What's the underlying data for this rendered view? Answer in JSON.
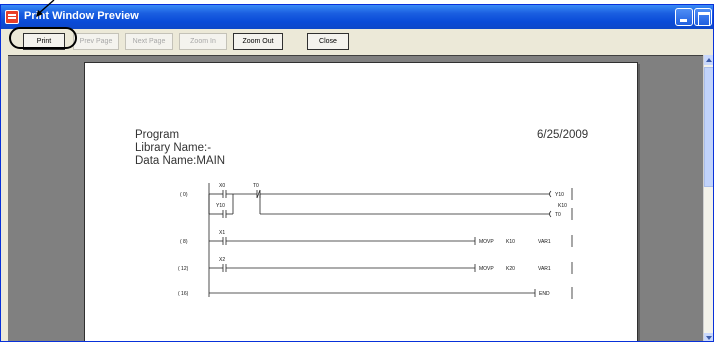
{
  "window": {
    "title": "Print Window Preview"
  },
  "toolbar": {
    "print": "Print",
    "prev_page": "Prev Page",
    "next_page": "Next Page",
    "zoom_in": "Zoom In",
    "zoom_out": "Zoom Out",
    "close": "Close"
  },
  "page": {
    "program_label": "Program",
    "library_name": "Library Name:-",
    "data_name": "Data Name:MAIN",
    "date": "6/25/2009"
  },
  "ladder": {
    "steps": [
      "( 0)",
      "( 8)",
      "( 12)",
      "( 16)"
    ],
    "x0": "X0",
    "t0": "T0",
    "y10": "Y10",
    "coil_y10": "Y10",
    "coil_t0": "T0",
    "k10": "K10",
    "x1": "X1",
    "x2": "X2",
    "movp": "MOVP",
    "k10b": "K10",
    "k20": "K20",
    "var1": "VAR1",
    "end": "END"
  },
  "colors": {
    "title_bar": "#0a4bd8",
    "preview_bg": "#808080",
    "window_bg": "#ece9d8"
  }
}
